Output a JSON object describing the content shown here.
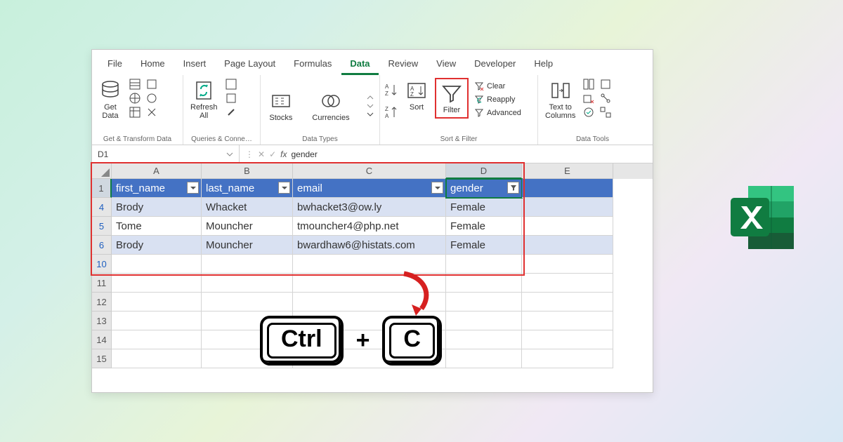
{
  "tabs": [
    "File",
    "Home",
    "Insert",
    "Page Layout",
    "Formulas",
    "Data",
    "Review",
    "View",
    "Developer",
    "Help"
  ],
  "activeTab": "Data",
  "ribbon": {
    "getData": "Get\nData",
    "refreshAll": "Refresh\nAll",
    "stocks": "Stocks",
    "currencies": "Currencies",
    "sort": "Sort",
    "filter": "Filter",
    "clear": "Clear",
    "reapply": "Reapply",
    "advanced": "Advanced",
    "textToColumns": "Text to\nColumns",
    "groups": {
      "g1": "Get & Transform Data",
      "g2": "Queries & Conne…",
      "g3": "Data Types",
      "g4": "Sort & Filter",
      "g5": "Data Tools"
    }
  },
  "nameBox": "D1",
  "formula": "gender",
  "columns": [
    "A",
    "B",
    "C",
    "D",
    "E"
  ],
  "headers": [
    "first_name",
    "last_name",
    "email",
    "gender"
  ],
  "rows": [
    {
      "n": "4",
      "cells": [
        "Brody",
        "Whacket",
        "bwhacket3@ow.ly",
        "Female"
      ],
      "band": 1
    },
    {
      "n": "5",
      "cells": [
        "Tome",
        "Mouncher",
        "tmouncher4@php.net",
        "Female"
      ],
      "band": 0
    },
    {
      "n": "6",
      "cells": [
        "Brody",
        "Mouncher",
        "bwardhaw6@histats.com",
        "Female"
      ],
      "band": 1
    }
  ],
  "emptyRows": [
    "10",
    "11",
    "12",
    "13",
    "14",
    "15"
  ],
  "shortcut": {
    "key1": "Ctrl",
    "plus": "+",
    "key2": "C"
  },
  "chart_data": {
    "type": "table",
    "columns": [
      "first_name",
      "last_name",
      "email",
      "gender"
    ],
    "rows": [
      [
        "Brody",
        "Whacket",
        "bwhacket3@ow.ly",
        "Female"
      ],
      [
        "Tome",
        "Mouncher",
        "tmouncher4@php.net",
        "Female"
      ],
      [
        "Brody",
        "Mouncher",
        "bwardhaw6@histats.com",
        "Female"
      ]
    ]
  }
}
